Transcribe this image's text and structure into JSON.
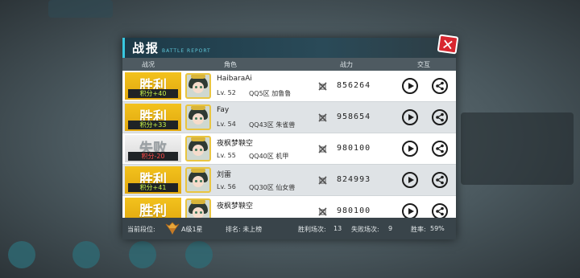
{
  "panel": {
    "title": "战报",
    "subtitle": "BATTLE REPORT"
  },
  "columns": {
    "status": "战况",
    "role": "角色",
    "power": "战力",
    "interact": "交互"
  },
  "rows": [
    {
      "result": "胜利",
      "points": "积分+40",
      "name": "HaibaraAi",
      "level": "Lv. 52",
      "server": "QQ5区 加鲁鲁",
      "power": "856264",
      "outcome": "win"
    },
    {
      "result": "胜利",
      "points": "积分+33",
      "name": "Fay",
      "level": "Lv. 54",
      "server": "QQ43区 朱雀兽",
      "power": "958654",
      "outcome": "win"
    },
    {
      "result": "失败",
      "points": "积分-20",
      "name": "夜枫梦鞅空",
      "level": "Lv. 55",
      "server": "QQ40区 机甲",
      "power": "980100",
      "outcome": "loss"
    },
    {
      "result": "胜利",
      "points": "积分+41",
      "name": "刘雷",
      "level": "Lv. 56",
      "server": "QQ30区 仙女兽",
      "power": "824993",
      "outcome": "win"
    },
    {
      "result": "胜利",
      "points": "",
      "name": "夜枫梦鞅空",
      "level": "",
      "server": "",
      "power": "980100",
      "outcome": "win"
    }
  ],
  "footer": {
    "rank_label": "当前段位:",
    "rank_value": "A级1星",
    "ranking": "排名: 未上榜",
    "wins_label": "胜利场次:",
    "wins": "13",
    "losses_label": "失败场次:",
    "losses": "9",
    "winrate_label": "胜率:",
    "winrate": "59%"
  },
  "colors": {
    "win": "#e9b316",
    "loss": "#e6e6e6",
    "close": "#d8262f",
    "accent": "#38c8e0"
  },
  "icons": {
    "close": "close-icon",
    "play": "play-icon",
    "share": "share-icon",
    "power": "power-icon",
    "rank": "rank-badge-icon"
  }
}
